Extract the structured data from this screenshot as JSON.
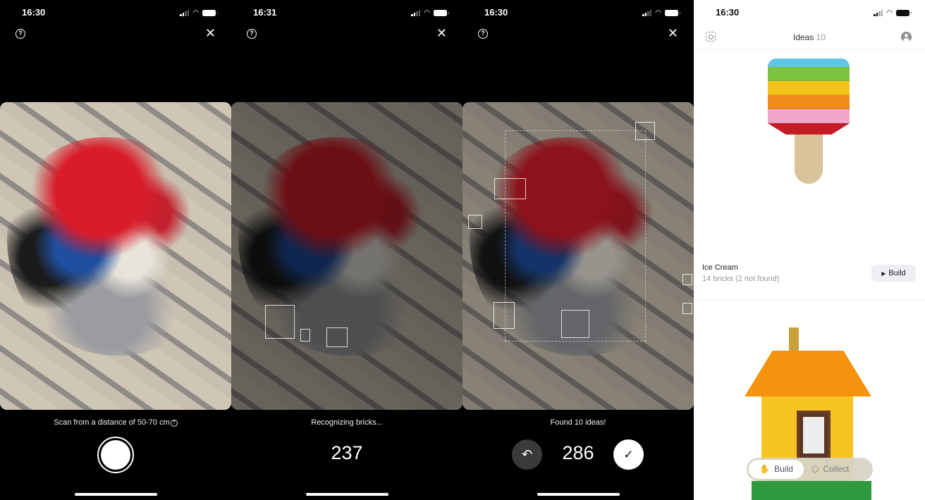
{
  "screens": [
    {
      "time": "16:30",
      "caption": "Scan from a distance of 50-70 cm",
      "caption_icon": "?",
      "help_icon": "?",
      "close_icon": "✕"
    },
    {
      "time": "16:31",
      "caption": "Recognizing bricks...",
      "count": "237",
      "help_icon": "?",
      "close_icon": "✕"
    },
    {
      "time": "16:30",
      "caption": "Found 10 ideas!",
      "count": "286",
      "undo_icon": "↶",
      "confirm_icon": "✓",
      "help_icon": "?",
      "close_icon": "✕"
    }
  ],
  "ideas": {
    "time": "16:30",
    "title": "Ideas",
    "count": "10",
    "items": [
      {
        "name": "Ice Cream",
        "subtitle": "14 bricks (2 not found)",
        "action": "Build",
        "action_icon": "▶"
      }
    ],
    "tabs": [
      {
        "label": "Build",
        "icon": "✋",
        "active": true
      },
      {
        "label": "Collect",
        "icon": "⬡",
        "active": false
      }
    ]
  }
}
